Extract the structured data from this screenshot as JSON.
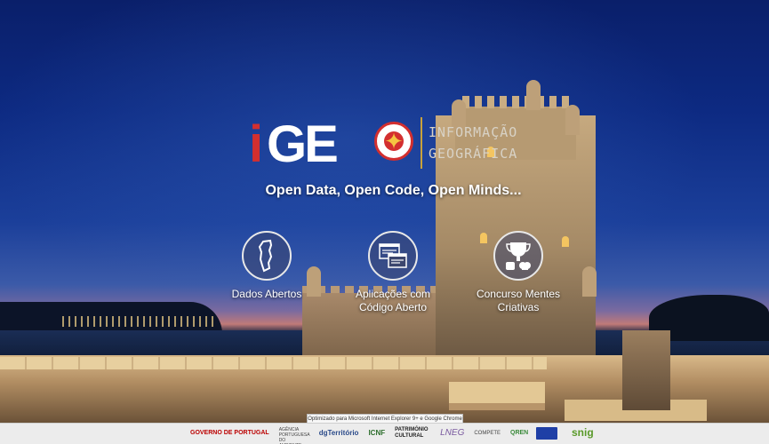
{
  "logo": {
    "letter_i": "i",
    "letters_geo": "GE",
    "subtitle_line1": "INFORMAÇÃO",
    "subtitle_line2": "GEOGRÁFICA"
  },
  "tagline": "Open Data, Open Code, Open Minds...",
  "tiles": [
    {
      "label": "Dados Abertos",
      "icon": "portugal-map-icon"
    },
    {
      "label_line1": "Aplicações com",
      "label_line2": "Código Aberto",
      "icon": "code-windows-icon"
    },
    {
      "label_line1": "Concurso Mentes",
      "label_line2": "Criativas",
      "icon": "trophy-icon"
    }
  ],
  "footer": {
    "optimized_note": "Optimizado para Microsoft Internet Explorer 9+ e Google Chrome",
    "partners": [
      "GOVERNO DE PORTUGAL",
      "AGÊNCIA PORTUGUESA DO AMBIENTE",
      "dgTerritório",
      "ICNF",
      "PATRIMÓNIO CULTURAL",
      "LNEG",
      "COMPETE",
      "QREN",
      "snig"
    ]
  },
  "colors": {
    "brand_red": "#d32f2f",
    "accent_gold": "#c9a23a",
    "snig_green": "#5a9a2a"
  }
}
